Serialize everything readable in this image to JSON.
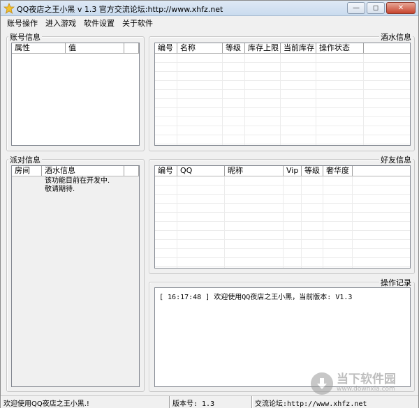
{
  "window": {
    "title": "QQ夜店之王小黑 v 1.3  官方交流论坛:http://www.xhfz.net",
    "buttons": {
      "minimize": "—",
      "maximize": "◻",
      "close": "✕"
    }
  },
  "menu": [
    "账号操作",
    "进入游戏",
    "软件设置",
    "关于软件"
  ],
  "account_panel": {
    "label": "账号信息",
    "columns": [
      "属性",
      "值",
      ""
    ]
  },
  "wine_panel": {
    "label": "酒水信息",
    "columns": [
      "编号",
      "名称",
      "等级",
      "库存上限",
      "当前库存",
      "操作状态",
      ""
    ]
  },
  "party_panel": {
    "label": "派对信息",
    "columns": [
      "房间",
      "酒水信息",
      ""
    ],
    "rows": [
      {
        "room": "",
        "info": "该功能目前在开发中."
      },
      {
        "room": "",
        "info": "敬请期待."
      }
    ]
  },
  "friends_panel": {
    "label": "好友信息",
    "columns": [
      "编号",
      "QQ",
      "昵称",
      "Vip",
      "等级",
      "奢华度",
      ""
    ]
  },
  "log_panel": {
    "label": "操作记录",
    "lines": [
      "[ 16:17:48 ] 欢迎使用QQ夜店之王小黑，当前版本: V1.3"
    ]
  },
  "statusbar": {
    "welcome": "欢迎使用QQ夜店之王小黑.!",
    "version": "版本号: 1.3",
    "forum": "交流论坛:http://www.xhfz.net"
  },
  "watermark": {
    "cn": "当下软件园",
    "en": "www.downxia.com"
  }
}
